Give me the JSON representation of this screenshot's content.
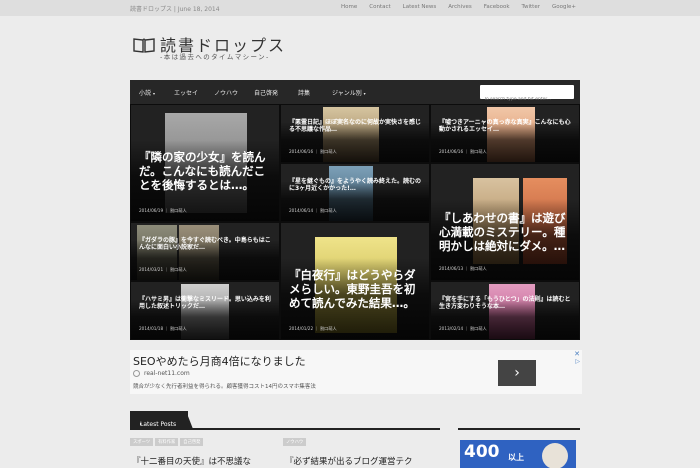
{
  "topbar": {
    "brand": "読書ドロップス",
    "date": "June 18, 2014",
    "links": [
      "Home",
      "Contact",
      "Latest News",
      "Archives",
      "Facebook",
      "Twitter",
      "Google+"
    ]
  },
  "header": {
    "title": "読書ドロップス",
    "subtitle": "-本は過去へのタイムマシーン-"
  },
  "nav": {
    "items": [
      "小説",
      "エッセイ",
      "ノウハウ",
      "自己啓発",
      "詩集",
      "ジャンル別"
    ],
    "search_placeholder": "To search type and hit enter..."
  },
  "tiles": [
    {
      "title": "『隣の家の少女』を読んだ。こんなにも読んだことを後悔するとは…。",
      "meta": "2014/06/19 ｜ 割口萌人"
    },
    {
      "title": "『悪霊日記』ほぼ実名なのに何故か実快さを感じる不思議な作品…",
      "meta": "2014/06/16 ｜ 割口萌人"
    },
    {
      "title": "『嘘つきアーニャの真っ赤な真実』こんなにも心動かされるエッセイ…",
      "meta": "2014/06/16 ｜ 割口萌人"
    },
    {
      "title": "『星を継ぐもの』をようやく読み終えた。読むのに3ヶ月近くかかった!…",
      "meta": "2014/06/14 ｜ 割口萌人"
    },
    {
      "title": "『ガダラの豚』を今すぐ読むべき。中島らもはこんなに面白い小説家だ…",
      "meta": "2014/03/21 ｜ 割口萌人"
    },
    {
      "title": "『しあわせの書』は遊び心満載のミステリー。種明かしは絶対にダメ。…",
      "meta": "2014/06/13 ｜ 割口萌人"
    },
    {
      "title": "『白夜行』はどうやらダメらしい。東野圭吾を初めて読んでみた結果…。",
      "meta": "2014/01/22 ｜ 割口萌人"
    },
    {
      "title": "『ハサミ男』は衝撃なミスリード。思い込みを利用した叙述トリックだ…",
      "meta": "2014/01/18 ｜ 割口萌人"
    },
    {
      "title": "『宮を手にする「もうひとつ」の法則』は読むと生き方変わりそうな本…",
      "meta": "2013/02/14 ｜ 割口萌人"
    }
  ],
  "ad": {
    "headline": "SEOやめたら月商4倍になりました",
    "url": "real-net11.com",
    "description": "競合が少なく先行者利益を得られる。顧客獲得コスト14円のスマホ集客法",
    "button": "›",
    "close": "✕",
    "info": "▷"
  },
  "latest": {
    "tab_label": "Latest Posts",
    "tab_arrow": "▸",
    "posts": [
      {
        "tags": [
          "スポーツ",
          "有料作家",
          "自己啓発"
        ],
        "title": "『十二番目の天使』は不思議な"
      },
      {
        "tags": [
          "ノウハウ"
        ],
        "title": "『必ず結果が出るブログ運営テク"
      }
    ]
  },
  "side_ad": {
    "big": "400",
    "small": "以上"
  },
  "colors": {
    "nav_bg": "#272727",
    "page_bg": "#ececec",
    "accent_blue": "#2f62c1"
  }
}
